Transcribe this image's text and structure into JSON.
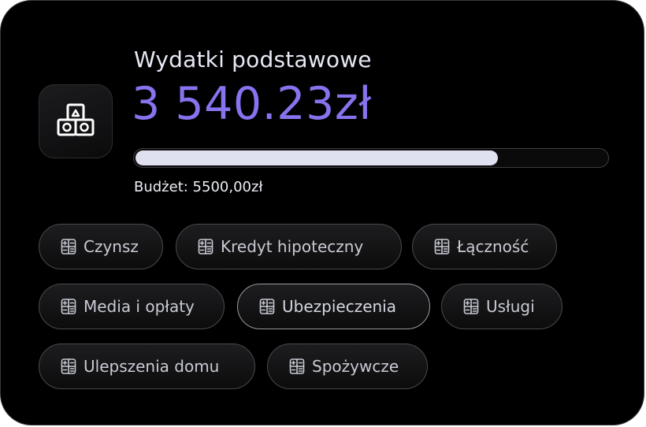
{
  "card": {
    "title": "Wydatki podstawowe",
    "amount": "3 540.23zł",
    "budget_label": "Budżet: 5500,00zł",
    "progress_fraction": 0.77,
    "icon": "blocks-icon",
    "colors": {
      "accent": "#8673ee",
      "progress_fill": "#dfe1f0",
      "background": "#000000"
    }
  },
  "categories": [
    {
      "label": "Czynsz",
      "icon": "calculator-icon"
    },
    {
      "label": "Kredyt hipoteczny",
      "icon": "calculator-icon"
    },
    {
      "label": "Łączność",
      "icon": "calculator-icon"
    },
    {
      "label": "Media i opłaty",
      "icon": "calculator-icon"
    },
    {
      "label": "Ubezpieczenia",
      "icon": "calculator-icon",
      "active": true
    },
    {
      "label": "Usługi",
      "icon": "calculator-icon"
    },
    {
      "label": "Ulepszenia domu",
      "icon": "calculator-icon"
    },
    {
      "label": "Spożywcze",
      "icon": "calculator-icon"
    }
  ]
}
